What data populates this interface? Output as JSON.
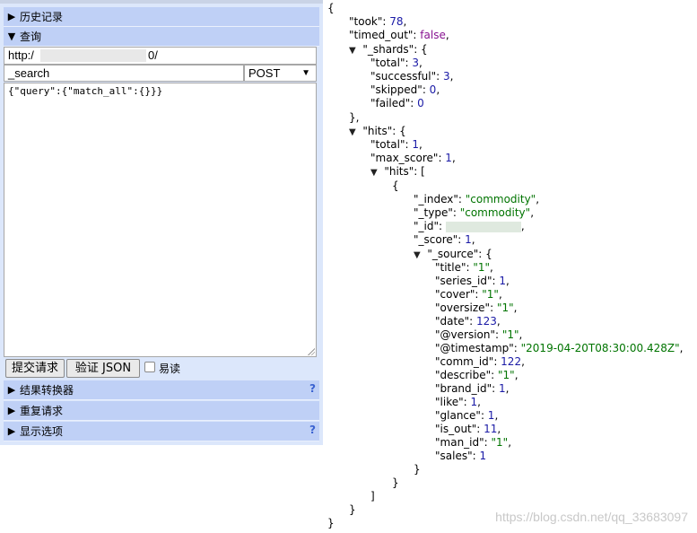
{
  "left_panel": {
    "history_label": "历史记录",
    "query_label": "查询",
    "url_prefix": "http:/",
    "url_suffix": "0/",
    "path_value": "_search",
    "method_value": "POST",
    "body_value": "{\"query\":{\"match_all\":{}}}",
    "submit_label": "提交请求",
    "validate_label": "验证 JSON",
    "easy_read_label": "易读",
    "transformer_label": "结果转换器",
    "repeat_label": "重复请求",
    "display_label": "显示选项",
    "help_mark": "?"
  },
  "json_view": {
    "open_brace": "{",
    "took_key": "\"took\"",
    "took_val": "78",
    "timed_out_key": "\"timed_out\"",
    "timed_out_val": "false",
    "shards_key": "\"_shards\"",
    "total_key": "\"total\"",
    "shards_total": "3",
    "successful_key": "\"successful\"",
    "successful_val": "3",
    "skipped_key": "\"skipped\"",
    "skipped_val": "0",
    "failed_key": "\"failed\"",
    "failed_val": "0",
    "hits_key": "\"hits\"",
    "hits_total": "1",
    "max_score_key": "\"max_score\"",
    "max_score_val": "1",
    "index_key": "\"_index\"",
    "index_val": "\"commodity\"",
    "type_key": "\"_type\"",
    "type_val": "\"commodity\"",
    "id_key": "\"_id\"",
    "score_key": "\"_score\"",
    "score_val": "1",
    "source_key": "\"_source\"",
    "title_key": "\"title\"",
    "title_val": "\"1\"",
    "series_id_key": "\"series_id\"",
    "series_id_val": "1",
    "cover_key": "\"cover\"",
    "cover_val": "\"1\"",
    "oversize_key": "\"oversize\"",
    "oversize_val": "\"1\"",
    "date_key": "\"date\"",
    "date_val": "123",
    "version_key": "\"@version\"",
    "version_val": "\"1\"",
    "timestamp_key": "\"@timestamp\"",
    "timestamp_val": "\"2019-04-20T08:30:00.428Z\"",
    "comm_id_key": "\"comm_id\"",
    "comm_id_val": "122",
    "describe_key": "\"describe\"",
    "describe_val": "\"1\"",
    "brand_id_key": "\"brand_id\"",
    "brand_id_val": "1",
    "like_key": "\"like\"",
    "like_val": "1",
    "glance_key": "\"glance\"",
    "glance_val": "1",
    "is_out_key": "\"is_out\"",
    "is_out_val": "11",
    "man_id_key": "\"man_id\"",
    "man_id_val": "\"1\"",
    "sales_key": "\"sales\"",
    "sales_val": "1"
  },
  "watermark": "https://blog.csdn.net/qq_33683097",
  "colors": {
    "panel_bg": "#dce7fb",
    "bar_bg": "#bfd0f6",
    "number": "#1a1aa6",
    "string": "#007400",
    "boolean": "#881391"
  },
  "icons": [
    "triangle-right-icon",
    "triangle-down-icon",
    "help-icon",
    "dropdown-arrow-icon",
    "resize-grip-icon"
  ]
}
